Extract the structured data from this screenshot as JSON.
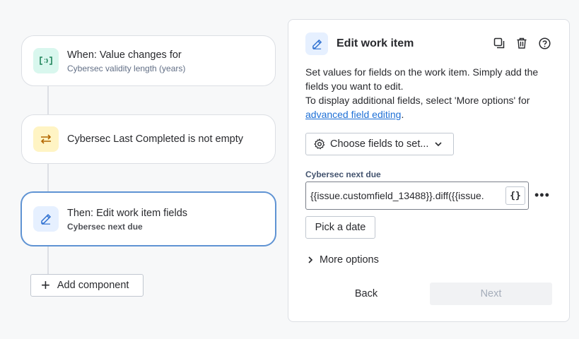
{
  "flow": {
    "trigger": {
      "title": "When: Value changes for",
      "subtitle": "Cybersec validity length (years)"
    },
    "condition": {
      "title": "Cybersec Last Completed is not empty"
    },
    "action": {
      "title": "Then: Edit work item fields",
      "subtitle": "Cybersec next due"
    },
    "add_component_label": "Add component"
  },
  "panel": {
    "title": "Edit work item",
    "description_line1": "Set values for fields on the work item. Simply add the fields you want to edit.",
    "description_line2": "To display additional fields, select 'More options' for",
    "description_link": "advanced field editing",
    "description_end": ".",
    "choose_fields_label": "Choose fields to set...",
    "field": {
      "label": "Cybersec next due",
      "value": "{{issue.customfield_13488}}.diff({{issue.",
      "smart_value_button": "{}"
    },
    "pick_date_label": "Pick a date",
    "more_options_label": "More options",
    "back_label": "Back",
    "next_label": "Next"
  },
  "icons": {
    "trigger": "value-change-icon",
    "condition": "swap-arrows-icon",
    "action": "edit-pencil-icon",
    "copy": "copy-icon",
    "delete": "trash-icon",
    "help": "help-icon",
    "settings": "gear-icon"
  },
  "colors": {
    "selected_border": "#5f93d3",
    "link": "#1d6fd6",
    "trigger_bg": "#d9f7ee",
    "condition_bg": "#fff4c4",
    "action_bg": "#e6f0ff"
  }
}
